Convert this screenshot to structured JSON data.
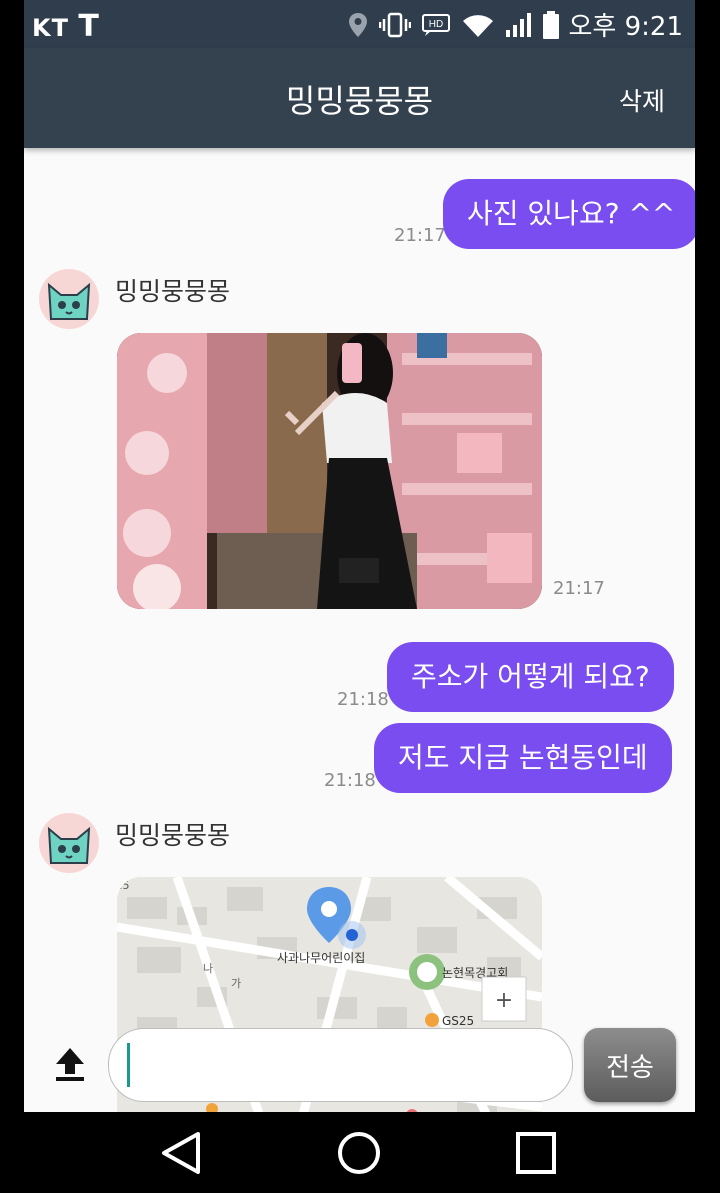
{
  "status_bar": {
    "carrier": "KT",
    "carrier2": "T",
    "time": "오후 9:21",
    "hd_badge": "HD"
  },
  "header": {
    "title": "밍밍뭉뭉몽",
    "delete_label": "삭제"
  },
  "messages": {
    "m1": {
      "text": "사진 있나요? ^^",
      "time": "21:17"
    },
    "r1": {
      "sender": "밍밍뭉뭉몽",
      "time": "21:17"
    },
    "m2": {
      "text": "주소가 어떻게 되요?",
      "time": "21:18"
    },
    "m3": {
      "text": "저도 지금 논현동인데",
      "time": "21:18"
    },
    "r2": {
      "sender": "밍밍뭉뭉몽"
    }
  },
  "map": {
    "place_label": "사과나무어린이집",
    "police_label": "논현목경고회",
    "store_label": "GS25",
    "street_label_1": "나",
    "street_label_2": "가",
    "zoom_plus": "+",
    "edge_label": ".5"
  },
  "composer": {
    "placeholder": "",
    "send_label": "전송"
  },
  "colors": {
    "app_bar": "#34414f",
    "bubble": "#7a4df0",
    "background": "#fafafa"
  },
  "icons": {
    "upload": "upload-icon",
    "back": "back-triangle-icon",
    "home": "home-circle-icon",
    "recent": "recent-square-icon"
  }
}
